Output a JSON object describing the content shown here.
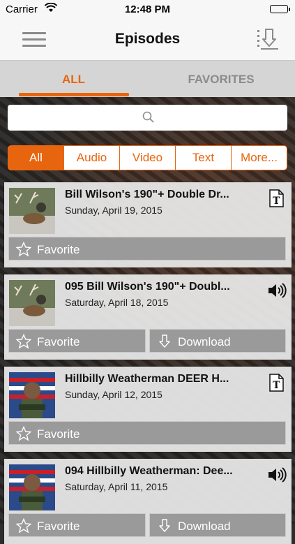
{
  "status_bar": {
    "carrier": "Carrier",
    "time": "12:48 PM"
  },
  "nav": {
    "title": "Episodes",
    "menu_icon": "hamburger-menu-icon",
    "download_icon": "download-all-icon"
  },
  "tabs": [
    {
      "label": "ALL",
      "active": true
    },
    {
      "label": "FAVORITES",
      "active": false
    }
  ],
  "search": {
    "placeholder": ""
  },
  "filters": [
    "All",
    "Audio",
    "Video",
    "Text",
    "More..."
  ],
  "accent_color": "#e8650f",
  "episodes": [
    {
      "title": "Bill Wilson's 190\"+ Double Dr...",
      "date": "Sunday, April 19, 2015",
      "type": "text",
      "favorite_label": "Favorite"
    },
    {
      "title": "095 Bill Wilson's 190\"+ Doubl...",
      "date": "Saturday, April 18, 2015",
      "type": "audio",
      "favorite_label": "Favorite",
      "download_label": "Download"
    },
    {
      "title": "Hillbilly Weatherman  DEER H...",
      "date": "Sunday, April 12, 2015",
      "type": "text",
      "favorite_label": "Favorite"
    },
    {
      "title": "094 Hillbilly Weatherman: Dee...",
      "date": "Saturday, April 11, 2015",
      "type": "audio",
      "favorite_label": "Favorite",
      "download_label": "Download"
    }
  ]
}
